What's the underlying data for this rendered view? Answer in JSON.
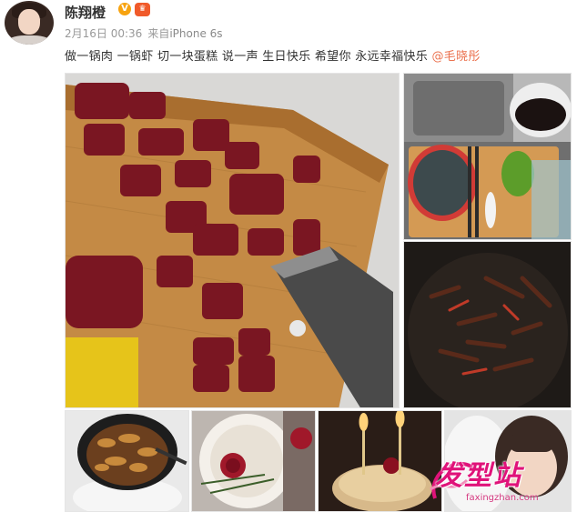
{
  "post": {
    "author": "陈翔橙",
    "verified_badge": "V",
    "level_badge": "♛",
    "date": "2月16日 00:36",
    "source_prefix": "来自",
    "device": "iPhone 6s",
    "text": "做一锅肉 一锅虾 切一块蛋糕 说一声 生日快乐 希望你 永远幸福快乐 ",
    "mention": "@毛晓彤"
  },
  "watermark": {
    "logo": "发型站",
    "url": "faxingzhan.com"
  },
  "colors": {
    "mention": "#eb7350",
    "verified": "#f7a310",
    "watermark": "#e0137a"
  },
  "icons": {
    "verified": "verified-icon",
    "level": "crown-icon"
  }
}
